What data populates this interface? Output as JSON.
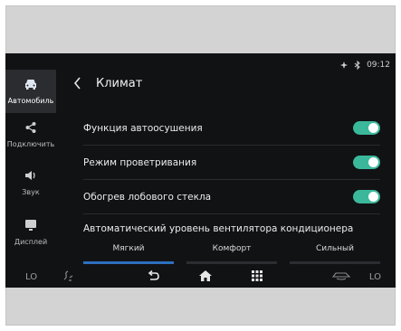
{
  "status": {
    "time": "09:12",
    "icons": [
      "fan-icon",
      "bluetooth-icon"
    ]
  },
  "sidebar": {
    "items": [
      {
        "label": "Автомобиль",
        "icon": "car-icon",
        "active": true
      },
      {
        "label": "Подключить",
        "icon": "share-icon",
        "active": false
      },
      {
        "label": "Звук",
        "icon": "speaker-icon",
        "active": false
      },
      {
        "label": "Дисплей",
        "icon": "display-icon",
        "active": false
      }
    ]
  },
  "header": {
    "title": "Климат"
  },
  "settings": {
    "rows": [
      {
        "label": "Функция автоосушения",
        "enabled": true
      },
      {
        "label": "Режим проветривания",
        "enabled": true
      },
      {
        "label": "Обогрев лобового стекла",
        "enabled": true
      }
    ],
    "fan_title": "Автоматический уровень вентилятора кондиционера",
    "fan_options": [
      "Мягкий",
      "Комфорт",
      "Сильный"
    ],
    "fan_selected": "Мягкий"
  },
  "bottom": {
    "left_temp": "LO",
    "right_temp": "LO"
  },
  "colors": {
    "accent_toggle": "#3bb89b",
    "selected_underline": "#2d6fbd",
    "screen_bg": "#111214"
  }
}
